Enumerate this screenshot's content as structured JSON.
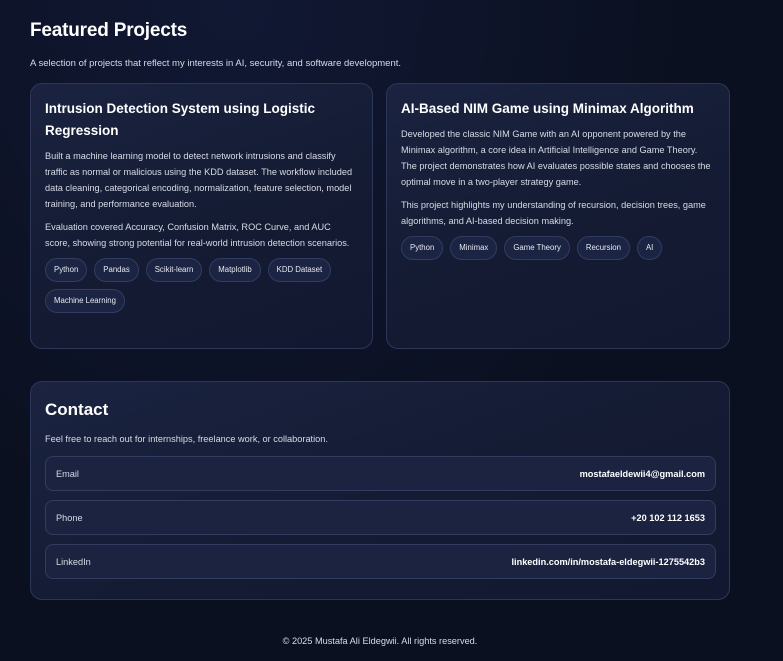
{
  "projects": {
    "title": "Featured Projects",
    "subtitle": "A selection of projects that reflect my interests in AI, security, and software development.",
    "items": [
      {
        "title": "Intrusion Detection System using Logistic Regression",
        "paragraphs": [
          "Built a machine learning model to detect network intrusions and classify traffic as normal or malicious using the KDD dataset. The workflow included data cleaning, categorical encoding, normalization, feature selection, model training, and performance evaluation.",
          "Evaluation covered Accuracy, Confusion Matrix, ROC Curve, and AUC score, showing strong potential for real-world intrusion detection scenarios."
        ],
        "tags": [
          "Python",
          "Pandas",
          "Scikit-learn",
          "Matplotlib",
          "KDD Dataset",
          "Machine Learning"
        ]
      },
      {
        "title": "AI-Based NIM Game using Minimax Algorithm",
        "paragraphs": [
          "Developed the classic NIM Game with an AI opponent powered by the Minimax algorithm, a core idea in Artificial Intelligence and Game Theory. The project demonstrates how AI evaluates possible states and chooses the optimal move in a two-player strategy game.",
          "This project highlights my understanding of recursion, decision trees, game algorithms, and AI-based decision making."
        ],
        "tags": [
          "Python",
          "Minimax",
          "Game Theory",
          "Recursion",
          "AI"
        ]
      }
    ]
  },
  "contact": {
    "title": "Contact",
    "subtitle": "Feel free to reach out for internships, freelance work, or collaboration.",
    "rows": [
      {
        "label": "Email",
        "value": "mostafaeldewii4@gmail.com"
      },
      {
        "label": "Phone",
        "value": "+20 102 112 1653"
      },
      {
        "label": "LinkedIn",
        "value": "linkedin.com/in/mostafa-eldegwii-1275542b3"
      }
    ]
  },
  "footer": {
    "text": "© 2025 Mustafa Ali Eldegwii. All rights reserved."
  }
}
